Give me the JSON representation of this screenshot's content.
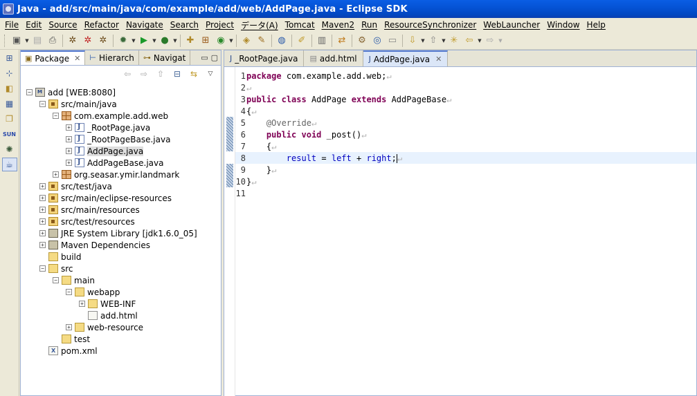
{
  "window": {
    "title": "Java - add/src/main/java/com/example/add/web/AddPage.java - Eclipse SDK"
  },
  "menu": [
    "File",
    "Edit",
    "Source",
    "Refactor",
    "Navigate",
    "Search",
    "Project",
    "データ(A)",
    "Tomcat",
    "Maven2",
    "Run",
    "ResourceSynchronizer",
    "WebLauncher",
    "Window",
    "Help"
  ],
  "left_panel": {
    "tabs": [
      {
        "label": "Package",
        "active": true
      },
      {
        "label": "Hierarch",
        "active": false
      },
      {
        "label": "Navigat",
        "active": false
      }
    ],
    "tree": [
      {
        "label": "add [WEB:8080]",
        "depth": 0,
        "icon": "project",
        "expander": "-"
      },
      {
        "label": "src/main/java",
        "depth": 1,
        "icon": "srcfolder",
        "expander": "-"
      },
      {
        "label": "com.example.add.web",
        "depth": 2,
        "icon": "package",
        "expander": "-"
      },
      {
        "label": "_RootPage.java",
        "depth": 3,
        "icon": "java",
        "expander": "+"
      },
      {
        "label": "_RootPageBase.java",
        "depth": 3,
        "icon": "java",
        "expander": "+"
      },
      {
        "label": "AddPage.java",
        "depth": 3,
        "icon": "java",
        "expander": "+",
        "selected": true
      },
      {
        "label": "AddPageBase.java",
        "depth": 3,
        "icon": "java",
        "expander": "+"
      },
      {
        "label": "org.seasar.ymir.landmark",
        "depth": 2,
        "icon": "package",
        "expander": "+"
      },
      {
        "label": "src/test/java",
        "depth": 1,
        "icon": "srcfolder",
        "expander": "+"
      },
      {
        "label": "src/main/eclipse-resources",
        "depth": 1,
        "icon": "srcfolder",
        "expander": "+"
      },
      {
        "label": "src/main/resources",
        "depth": 1,
        "icon": "srcfolder",
        "expander": "+"
      },
      {
        "label": "src/test/resources",
        "depth": 1,
        "icon": "srcfolder",
        "expander": "+"
      },
      {
        "label": "JRE System Library [jdk1.6.0_05]",
        "depth": 1,
        "icon": "jar",
        "expander": "+"
      },
      {
        "label": "Maven Dependencies",
        "depth": 1,
        "icon": "jar",
        "expander": "+"
      },
      {
        "label": "build",
        "depth": 1,
        "icon": "folder",
        "expander": ""
      },
      {
        "label": "src",
        "depth": 1,
        "icon": "folder",
        "expander": "-"
      },
      {
        "label": "main",
        "depth": 2,
        "icon": "folder",
        "expander": "-"
      },
      {
        "label": "webapp",
        "depth": 3,
        "icon": "folder",
        "expander": "-"
      },
      {
        "label": "WEB-INF",
        "depth": 4,
        "icon": "folder",
        "expander": "+"
      },
      {
        "label": "add.html",
        "depth": 4,
        "icon": "html",
        "expander": ""
      },
      {
        "label": "web-resource",
        "depth": 3,
        "icon": "folder",
        "expander": "+"
      },
      {
        "label": "test",
        "depth": 2,
        "icon": "folder",
        "expander": ""
      },
      {
        "label": "pom.xml",
        "depth": 1,
        "icon": "xml",
        "expander": ""
      }
    ]
  },
  "editor": {
    "tabs": [
      {
        "label": "_RootPage.java",
        "active": false
      },
      {
        "label": "add.html",
        "active": false
      },
      {
        "label": "AddPage.java",
        "active": true
      }
    ],
    "lines": [
      {
        "n": "1",
        "code": "package com.example.add.web;"
      },
      {
        "n": "2",
        "code": ""
      },
      {
        "n": "3",
        "code": "public class AddPage extends AddPageBase"
      },
      {
        "n": "4",
        "code": "{"
      },
      {
        "n": "5",
        "code": "    @Override"
      },
      {
        "n": "6",
        "code": "    public void _post()"
      },
      {
        "n": "7",
        "code": "    {"
      },
      {
        "n": "8",
        "code": "        result = left + right;"
      },
      {
        "n": "9",
        "code": "    }"
      },
      {
        "n": "10",
        "code": "}"
      },
      {
        "n": "11",
        "code": ""
      }
    ],
    "current_line": 8
  }
}
